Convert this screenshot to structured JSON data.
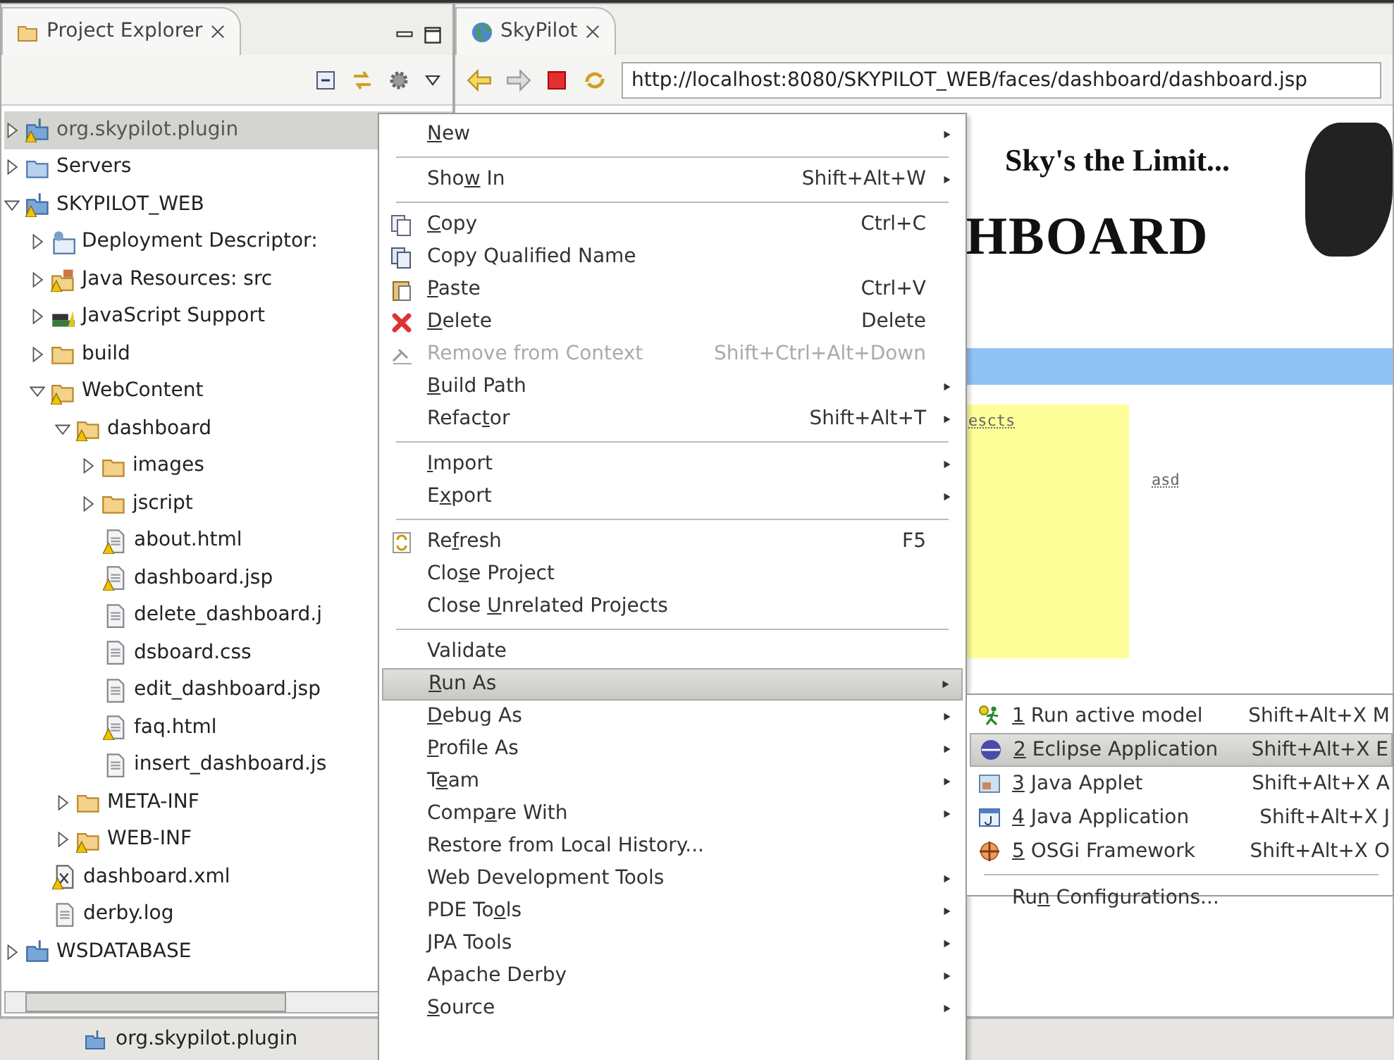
{
  "explorer": {
    "title": "Project Explorer",
    "tree": [
      {
        "label": "org.skypilot.plugin",
        "kind": "project",
        "warning": true,
        "selected": true,
        "expanded": false
      },
      {
        "label": "Servers",
        "kind": "servers",
        "warning": false,
        "selected": false,
        "expanded": false
      },
      {
        "label": "SKYPILOT_WEB",
        "kind": "project",
        "warning": true,
        "selected": false,
        "expanded": true,
        "children": [
          {
            "label": "Deployment Descriptor:",
            "kind": "descriptor",
            "warning": false,
            "selected": false,
            "expanded": false
          },
          {
            "label": "Java Resources: src",
            "kind": "javares",
            "warning": true,
            "selected": false,
            "expanded": false
          },
          {
            "label": "JavaScript Support",
            "kind": "library",
            "warning": false,
            "selected": false,
            "expanded": false
          },
          {
            "label": "build",
            "kind": "folder",
            "warning": false,
            "selected": false,
            "expanded": false
          },
          {
            "label": "WebContent",
            "kind": "folder",
            "warning": true,
            "selected": false,
            "expanded": true,
            "children": [
              {
                "label": "dashboard",
                "kind": "folder",
                "warning": true,
                "selected": false,
                "expanded": true,
                "children": [
                  {
                    "label": "images",
                    "kind": "folder",
                    "warning": false,
                    "selected": false,
                    "expanded": false
                  },
                  {
                    "label": "jscript",
                    "kind": "folder",
                    "warning": false,
                    "selected": false,
                    "expanded": false
                  },
                  {
                    "label": "about.html",
                    "kind": "file",
                    "warning": true,
                    "selected": false
                  },
                  {
                    "label": "dashboard.jsp",
                    "kind": "file",
                    "warning": true,
                    "selected": false
                  },
                  {
                    "label": "delete_dashboard.j",
                    "kind": "file",
                    "warning": false,
                    "selected": false
                  },
                  {
                    "label": "dsboard.css",
                    "kind": "file",
                    "warning": false,
                    "selected": false
                  },
                  {
                    "label": "edit_dashboard.jsp",
                    "kind": "file",
                    "warning": false,
                    "selected": false
                  },
                  {
                    "label": "faq.html",
                    "kind": "file",
                    "warning": true,
                    "selected": false
                  },
                  {
                    "label": "insert_dashboard.js",
                    "kind": "file",
                    "warning": false,
                    "selected": false
                  }
                ]
              },
              {
                "label": "META-INF",
                "kind": "folder",
                "warning": false,
                "selected": false,
                "expanded": false
              },
              {
                "label": "WEB-INF",
                "kind": "folder",
                "warning": true,
                "selected": false,
                "expanded": false
              }
            ]
          },
          {
            "label": "dashboard.xml",
            "kind": "xml",
            "warning": true,
            "selected": false
          },
          {
            "label": "derby.log",
            "kind": "file",
            "warning": false,
            "selected": false
          }
        ]
      },
      {
        "label": "WSDATABASE",
        "kind": "project",
        "warning": false,
        "selected": false,
        "expanded": false
      }
    ]
  },
  "editor": {
    "tab": "SkyPilot",
    "url": "http://localhost:8080/SKYPILOT_WEB/faces/dashboard/dashboard.jsp",
    "page": {
      "tagline": "Sky's the Limit...",
      "heading": "HBOARD",
      "link_1": "escts",
      "link_2": "asd"
    }
  },
  "context_menu": {
    "items": [
      {
        "kind": "item",
        "label": {
          "key": "N",
          "after": "ew"
        },
        "submenu": true,
        "disabled": false,
        "selected": false
      },
      {
        "kind": "separator"
      },
      {
        "kind": "item",
        "label": {
          "before": "Sho",
          "key": "w",
          "after": " In"
        },
        "shortcut": "Shift+Alt+W",
        "submenu": true,
        "disabled": false,
        "selected": false
      },
      {
        "kind": "separator"
      },
      {
        "kind": "item",
        "label": {
          "key": "C",
          "after": "opy"
        },
        "shortcut": "Ctrl+C",
        "submenu": false,
        "disabled": false,
        "selected": false
      },
      {
        "kind": "item",
        "label": "Copy Qualified Name",
        "submenu": false,
        "disabled": false,
        "selected": false
      },
      {
        "kind": "item",
        "label": {
          "key": "P",
          "after": "aste"
        },
        "shortcut": "Ctrl+V",
        "submenu": false,
        "disabled": false,
        "selected": false
      },
      {
        "kind": "item",
        "label": {
          "key": "D",
          "after": "elete"
        },
        "shortcut": "Delete",
        "submenu": false,
        "disabled": false,
        "selected": false
      },
      {
        "kind": "item",
        "label": "Remove from Context",
        "shortcut": "Shift+Ctrl+Alt+Down",
        "submenu": false,
        "disabled": true,
        "selected": false
      },
      {
        "kind": "item",
        "label": {
          "key": "B",
          "after": "uild Path"
        },
        "submenu": true,
        "disabled": false,
        "selected": false
      },
      {
        "kind": "item",
        "label": {
          "before": "Refac",
          "key": "t",
          "after": "or"
        },
        "shortcut": "Shift+Alt+T",
        "submenu": true,
        "disabled": false,
        "selected": false
      },
      {
        "kind": "separator"
      },
      {
        "kind": "item",
        "label": {
          "key": "I",
          "after": "mport"
        },
        "submenu": true,
        "disabled": false,
        "selected": false
      },
      {
        "kind": "item",
        "label": {
          "before": "E",
          "key": "x",
          "after": "port"
        },
        "submenu": true,
        "disabled": false,
        "selected": false
      },
      {
        "kind": "separator"
      },
      {
        "kind": "item",
        "label": {
          "before": "Re",
          "key": "f",
          "after": "resh"
        },
        "shortcut": "F5",
        "submenu": false,
        "disabled": false,
        "selected": false
      },
      {
        "kind": "item",
        "label": {
          "before": "Clo",
          "key": "s",
          "after": "e Project"
        },
        "submenu": false,
        "disabled": false,
        "selected": false
      },
      {
        "kind": "item",
        "label": {
          "before": "Close ",
          "key": "U",
          "after": "nrelated Projects"
        },
        "submenu": false,
        "disabled": false,
        "selected": false
      },
      {
        "kind": "separator"
      },
      {
        "kind": "item",
        "label": "Validate",
        "submenu": false,
        "disabled": false,
        "selected": false
      },
      {
        "kind": "item",
        "label": {
          "key": "R",
          "after": "un As"
        },
        "submenu": true,
        "disabled": false,
        "selected": true
      },
      {
        "kind": "item",
        "label": {
          "key": "D",
          "after": "ebug As"
        },
        "submenu": true,
        "disabled": false,
        "selected": false
      },
      {
        "kind": "item",
        "label": {
          "key": "P",
          "after": "rofile As"
        },
        "submenu": true,
        "disabled": false,
        "selected": false
      },
      {
        "kind": "item",
        "label": {
          "before": "T",
          "key": "e",
          "after": "am"
        },
        "submenu": true,
        "disabled": false,
        "selected": false
      },
      {
        "kind": "item",
        "label": {
          "before": "Comp",
          "key": "a",
          "after": "re With"
        },
        "submenu": true,
        "disabled": false,
        "selected": false
      },
      {
        "kind": "item",
        "label": "Restore from Local History...",
        "submenu": false,
        "disabled": false,
        "selected": false
      },
      {
        "kind": "item",
        "label": "Web Development Tools",
        "submenu": true,
        "disabled": false,
        "selected": false
      },
      {
        "kind": "item",
        "label": {
          "before": "PDE To",
          "key": "o",
          "after": "ls"
        },
        "submenu": true,
        "disabled": false,
        "selected": false
      },
      {
        "kind": "item",
        "label": "JPA Tools",
        "submenu": true,
        "disabled": false,
        "selected": false
      },
      {
        "kind": "item",
        "label": "Apache Derby",
        "submenu": true,
        "disabled": false,
        "selected": false
      },
      {
        "kind": "item",
        "label": {
          "key": "S",
          "after": "ource"
        },
        "submenu": true,
        "disabled": false,
        "selected": false
      }
    ]
  },
  "submenu": {
    "items": [
      {
        "kind": "item",
        "label": {
          "key": "1",
          "after": " Run active model"
        },
        "shortcut": "Shift+Alt+X M",
        "selected": false
      },
      {
        "kind": "item",
        "label": {
          "key": "2",
          "after": " Eclipse Application"
        },
        "shortcut": "Shift+Alt+X E",
        "selected": true
      },
      {
        "kind": "item",
        "label": {
          "key": "3",
          "after": " Java Applet"
        },
        "shortcut": "Shift+Alt+X A",
        "selected": false
      },
      {
        "kind": "item",
        "label": {
          "key": "4",
          "after": " Java Application"
        },
        "shortcut": "Shift+Alt+X J",
        "selected": false
      },
      {
        "kind": "item",
        "label": {
          "key": "5",
          "after": " OSGi Framework"
        },
        "shortcut": "Shift+Alt+X O",
        "selected": false
      },
      {
        "kind": "separator"
      },
      {
        "kind": "item",
        "label": {
          "before": "Ru",
          "key": "n",
          "after": " Configurations..."
        },
        "selected": false
      }
    ]
  },
  "status_bar": {
    "text": "org.skypilot.plugin"
  }
}
